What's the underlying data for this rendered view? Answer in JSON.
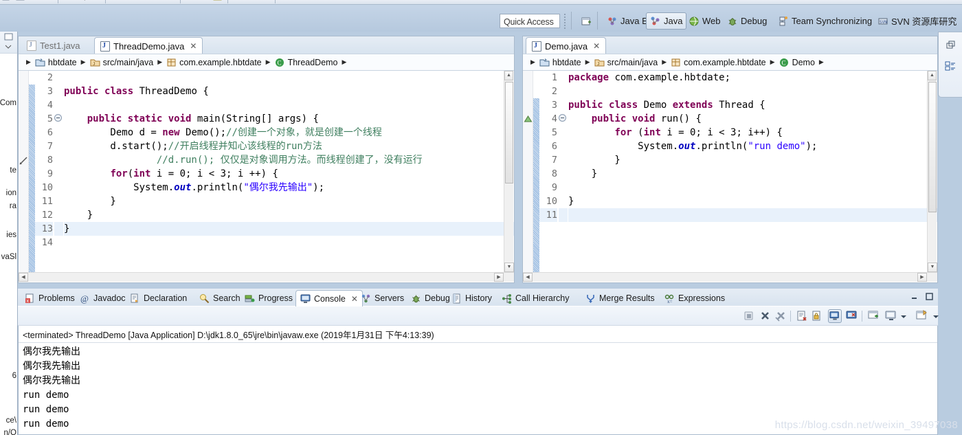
{
  "toolbar": {
    "quick_access_placeholder": "Quick Access",
    "quick_access_value": "Quick Access"
  },
  "perspectives": {
    "open_perspective_label": "",
    "items": [
      {
        "label": "Java EE",
        "icon": "java-ee-perspective-icon",
        "active": false
      },
      {
        "label": "Java",
        "icon": "java-perspective-icon",
        "active": true
      },
      {
        "label": "Web",
        "icon": "web-perspective-icon",
        "active": false
      },
      {
        "label": "Debug",
        "icon": "debug-perspective-icon",
        "active": false
      },
      {
        "label": "Team Synchronizing",
        "icon": "team-sync-perspective-icon",
        "active": false
      },
      {
        "label": "SVN 资源库研究",
        "icon": "svn-repo-perspective-icon",
        "active": false
      }
    ]
  },
  "left_strip": {
    "clipped_labels": [
      "Com",
      "te",
      "ion",
      "ra",
      "ies",
      "vaSl",
      "6",
      "ce\\",
      "n/Q"
    ]
  },
  "editor_left": {
    "tabs": [
      {
        "label": "Test1.java",
        "active": false,
        "closable": false
      },
      {
        "label": "ThreadDemo.java",
        "active": true,
        "closable": true
      }
    ],
    "breadcrumb": [
      {
        "label": "hbtdate",
        "icon": "project-icon"
      },
      {
        "label": "src/main/java",
        "icon": "source-folder-icon"
      },
      {
        "label": "com.example.hbtdate",
        "icon": "package-icon"
      },
      {
        "label": "ThreadDemo",
        "icon": "class-icon"
      }
    ],
    "first_line_number": 2,
    "lines": [
      {
        "n": 2,
        "fold": "",
        "current": false,
        "tokens": []
      },
      {
        "n": 3,
        "fold": "",
        "current": false,
        "tokens": [
          {
            "t": "public",
            "c": "kw"
          },
          {
            "t": " ",
            "c": ""
          },
          {
            "t": "class",
            "c": "kw"
          },
          {
            "t": " ThreadDemo {",
            "c": ""
          }
        ]
      },
      {
        "n": 4,
        "fold": "",
        "current": false,
        "tokens": []
      },
      {
        "n": 5,
        "fold": "minus",
        "current": false,
        "tokens": [
          {
            "t": "    ",
            "c": ""
          },
          {
            "t": "public",
            "c": "kw"
          },
          {
            "t": " ",
            "c": ""
          },
          {
            "t": "static",
            "c": "kw"
          },
          {
            "t": " ",
            "c": ""
          },
          {
            "t": "void",
            "c": "kw"
          },
          {
            "t": " main(String[] args) {",
            "c": ""
          }
        ]
      },
      {
        "n": 6,
        "fold": "",
        "current": false,
        "tokens": [
          {
            "t": "        Demo d = ",
            "c": ""
          },
          {
            "t": "new",
            "c": "kw"
          },
          {
            "t": " Demo();",
            "c": ""
          },
          {
            "t": "//创建一个对象，就是创建一个线程",
            "c": "cmt"
          }
        ]
      },
      {
        "n": 7,
        "fold": "",
        "current": false,
        "tokens": [
          {
            "t": "        d.start();",
            "c": ""
          },
          {
            "t": "//开启线程并知心该线程的run方法",
            "c": "cmt"
          }
        ]
      },
      {
        "n": 8,
        "fold": "",
        "current": false,
        "tokens": [
          {
            "t": "                ",
            "c": ""
          },
          {
            "t": "//d.run(); 仅仅是对象调用方法。而线程创建了，没有运行",
            "c": "cmt"
          }
        ]
      },
      {
        "n": 9,
        "fold": "",
        "current": false,
        "tokens": [
          {
            "t": "        ",
            "c": ""
          },
          {
            "t": "for",
            "c": "kw"
          },
          {
            "t": "(",
            "c": ""
          },
          {
            "t": "int",
            "c": "kw"
          },
          {
            "t": " i = 0; i < 3; i ++) {",
            "c": ""
          }
        ]
      },
      {
        "n": 10,
        "fold": "",
        "current": false,
        "tokens": [
          {
            "t": "            System.",
            "c": ""
          },
          {
            "t": "out",
            "c": "fld"
          },
          {
            "t": ".println(",
            "c": ""
          },
          {
            "t": "\"偶尔我先输出\"",
            "c": "str"
          },
          {
            "t": ");",
            "c": ""
          }
        ]
      },
      {
        "n": 11,
        "fold": "",
        "current": false,
        "tokens": [
          {
            "t": "        }",
            "c": ""
          }
        ]
      },
      {
        "n": 12,
        "fold": "",
        "current": false,
        "tokens": [
          {
            "t": "    }",
            "c": ""
          }
        ]
      },
      {
        "n": 13,
        "fold": "",
        "current": true,
        "tokens": [
          {
            "t": "}",
            "c": ""
          }
        ]
      },
      {
        "n": 14,
        "fold": "",
        "current": false,
        "tokens": []
      }
    ]
  },
  "editor_right": {
    "tabs": [
      {
        "label": "Demo.java",
        "active": true,
        "closable": true
      }
    ],
    "breadcrumb": [
      {
        "label": "hbtdate",
        "icon": "project-icon"
      },
      {
        "label": "src/main/java",
        "icon": "source-folder-icon"
      },
      {
        "label": "com.example.hbtdate",
        "icon": "package-icon"
      },
      {
        "label": "Demo",
        "icon": "class-icon"
      }
    ],
    "first_line_number": 1,
    "lines": [
      {
        "n": 1,
        "fold": "",
        "current": false,
        "tokens": [
          {
            "t": "package",
            "c": "kw"
          },
          {
            "t": " com.example.hbtdate;",
            "c": ""
          }
        ]
      },
      {
        "n": 2,
        "fold": "",
        "current": false,
        "tokens": []
      },
      {
        "n": 3,
        "fold": "",
        "current": false,
        "tokens": [
          {
            "t": "public",
            "c": "kw"
          },
          {
            "t": " ",
            "c": ""
          },
          {
            "t": "class",
            "c": "kw"
          },
          {
            "t": " Demo ",
            "c": ""
          },
          {
            "t": "extends",
            "c": "kw"
          },
          {
            "t": " Thread {",
            "c": ""
          }
        ]
      },
      {
        "n": 4,
        "fold": "minus",
        "current": false,
        "tokens": [
          {
            "t": "    ",
            "c": ""
          },
          {
            "t": "public",
            "c": "kw"
          },
          {
            "t": " ",
            "c": ""
          },
          {
            "t": "void",
            "c": "kw"
          },
          {
            "t": " run() {",
            "c": ""
          }
        ]
      },
      {
        "n": 5,
        "fold": "",
        "current": false,
        "tokens": [
          {
            "t": "        ",
            "c": ""
          },
          {
            "t": "for",
            "c": "kw"
          },
          {
            "t": " (",
            "c": ""
          },
          {
            "t": "int",
            "c": "kw"
          },
          {
            "t": " i = 0; i < 3; i++) {",
            "c": ""
          }
        ]
      },
      {
        "n": 6,
        "fold": "",
        "current": false,
        "tokens": [
          {
            "t": "            System.",
            "c": ""
          },
          {
            "t": "out",
            "c": "fld"
          },
          {
            "t": ".println(",
            "c": ""
          },
          {
            "t": "\"run demo\"",
            "c": "str"
          },
          {
            "t": ");",
            "c": ""
          }
        ]
      },
      {
        "n": 7,
        "fold": "",
        "current": false,
        "tokens": [
          {
            "t": "        }",
            "c": ""
          }
        ]
      },
      {
        "n": 8,
        "fold": "",
        "current": false,
        "tokens": [
          {
            "t": "    }",
            "c": ""
          }
        ]
      },
      {
        "n": 9,
        "fold": "",
        "current": false,
        "tokens": []
      },
      {
        "n": 10,
        "fold": "",
        "current": false,
        "tokens": [
          {
            "t": "}",
            "c": ""
          }
        ]
      },
      {
        "n": 11,
        "fold": "",
        "current": true,
        "tokens": []
      }
    ]
  },
  "bottom_view": {
    "tabs": [
      {
        "label": "Problems",
        "icon": "problems-icon",
        "active": false,
        "closable": false
      },
      {
        "label": "Javadoc",
        "icon": "javadoc-icon",
        "active": false,
        "closable": false
      },
      {
        "label": "Declaration",
        "icon": "declaration-icon",
        "active": false,
        "closable": false
      },
      {
        "label": "Search",
        "icon": "search-icon",
        "active": false,
        "closable": false
      },
      {
        "label": "Progress",
        "icon": "progress-icon",
        "active": false,
        "closable": false
      },
      {
        "label": "Console",
        "icon": "console-icon",
        "active": true,
        "closable": true
      },
      {
        "label": "Servers",
        "icon": "servers-icon",
        "active": false,
        "closable": false
      },
      {
        "label": "Debug",
        "icon": "debug-icon",
        "active": false,
        "closable": false
      },
      {
        "label": "History",
        "icon": "history-icon",
        "active": false,
        "closable": false
      },
      {
        "label": "Call Hierarchy",
        "icon": "call-hierarchy-icon",
        "active": false,
        "closable": false
      },
      {
        "label": "Merge Results",
        "icon": "merge-results-icon",
        "active": false,
        "closable": false
      },
      {
        "label": "Expressions",
        "icon": "expressions-icon",
        "active": false,
        "closable": false
      }
    ],
    "window_controls": [
      {
        "name": "minimize-view-button",
        "icon": "minimize-icon"
      },
      {
        "name": "maximize-view-button",
        "icon": "maximize-icon"
      }
    ]
  },
  "console": {
    "toolbar_icons": [
      "terminate-icon",
      "remove-launch-icon",
      "remove-all-terminated-icon",
      "clear-console-icon",
      "scroll-lock-icon",
      "show-console-on-output-icon",
      "pin-console-icon",
      "display-selected-console-icon",
      "display-dropdown-icon",
      "open-console-icon",
      "open-console-dropdown-icon"
    ],
    "status_line": "<terminated> ThreadDemo [Java Application] D:\\jdk1.8.0_65\\jre\\bin\\javaw.exe (2019年1月31日 下午4:13:39)",
    "output": [
      "偶尔我先输出",
      "偶尔我先输出",
      "偶尔我先输出",
      "run demo",
      "run demo",
      "run demo"
    ]
  },
  "right_bar": {
    "icons": [
      "restore-view-icon",
      "outline-view-icon"
    ]
  },
  "watermark": "https://blog.csdn.net/weixin_39497038",
  "colors": {
    "chrome": "#b9cce0",
    "keyword": "#7f0055",
    "string": "#2a00ff",
    "comment": "#3f7f5f",
    "field": "#0000c0",
    "current_line": "#e8f1fb"
  }
}
